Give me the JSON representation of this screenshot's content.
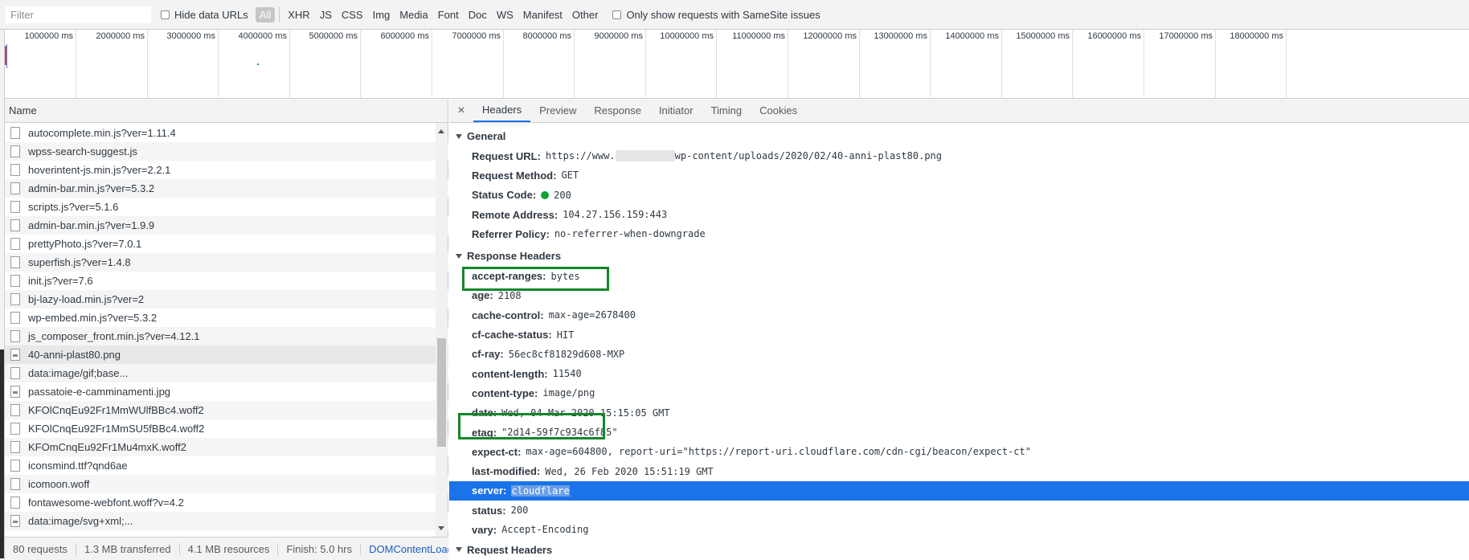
{
  "toolbar": {
    "filter_placeholder": "Filter",
    "hide_data_urls": "Hide data URLs",
    "types": [
      "All",
      "XHR",
      "JS",
      "CSS",
      "Img",
      "Media",
      "Font",
      "Doc",
      "WS",
      "Manifest",
      "Other"
    ],
    "active_type": "All",
    "samesite_label": "Only show requests with SameSite issues"
  },
  "overview": {
    "ticks": [
      "1000000 ms",
      "2000000 ms",
      "3000000 ms",
      "4000000 ms",
      "5000000 ms",
      "6000000 ms",
      "7000000 ms",
      "8000000 ms",
      "9000000 ms",
      "10000000 ms",
      "11000000 ms",
      "12000000 ms",
      "13000000 ms",
      "14000000 ms",
      "15000000 ms",
      "16000000 ms",
      "17000000 ms",
      "18000000 ms"
    ]
  },
  "list": {
    "header": "Name",
    "rows": [
      {
        "name": "autocomplete.min.js?ver=1.11.4",
        "icon": "file-icon"
      },
      {
        "name": "wpss-search-suggest.js",
        "icon": "file-icon"
      },
      {
        "name": "hoverintent-js.min.js?ver=2.2.1",
        "icon": "file-icon"
      },
      {
        "name": "admin-bar.min.js?ver=5.3.2",
        "icon": "file-icon"
      },
      {
        "name": "scripts.js?ver=5.1.6",
        "icon": "file-icon"
      },
      {
        "name": "admin-bar.min.js?ver=1.9.9",
        "icon": "file-icon"
      },
      {
        "name": "prettyPhoto.js?ver=7.0.1",
        "icon": "file-icon"
      },
      {
        "name": "superfish.js?ver=1.4.8",
        "icon": "file-icon"
      },
      {
        "name": "init.js?ver=7.6",
        "icon": "file-icon"
      },
      {
        "name": "bj-lazy-load.min.js?ver=2",
        "icon": "file-icon"
      },
      {
        "name": "wp-embed.min.js?ver=5.3.2",
        "icon": "file-icon"
      },
      {
        "name": "js_composer_front.min.js?ver=4.12.1",
        "icon": "file-icon"
      },
      {
        "name": "40-anni-plast80.png",
        "icon": "image-file-icon"
      },
      {
        "name": "data:image/gif;base...",
        "icon": "file-icon"
      },
      {
        "name": "passatoie-e-camminamenti.jpg",
        "icon": "image-file-icon"
      },
      {
        "name": "KFOlCnqEu92Fr1MmWUlfBBc4.woff2",
        "icon": "file-icon"
      },
      {
        "name": "KFOlCnqEu92Fr1MmSU5fBBc4.woff2",
        "icon": "file-icon"
      },
      {
        "name": "KFOmCnqEu92Fr1Mu4mxK.woff2",
        "icon": "file-icon"
      },
      {
        "name": "iconsmind.ttf?qnd6ae",
        "icon": "file-icon"
      },
      {
        "name": "icomoon.woff",
        "icon": "file-icon"
      },
      {
        "name": "fontawesome-webfont.woff?v=4.2",
        "icon": "file-icon"
      },
      {
        "name": "data:image/svg+xml;...",
        "icon": "image-file-icon"
      }
    ]
  },
  "status_bar": {
    "requests": "80 requests",
    "transferred": "1.3 MB transferred",
    "resources": "4.1 MB resources",
    "finish": "Finish: 5.0 hrs",
    "dom_content_loaded": "DOMContentLoaded"
  },
  "details": {
    "tabs": [
      "Headers",
      "Preview",
      "Response",
      "Initiator",
      "Timing",
      "Cookies"
    ],
    "active_tab": "Headers",
    "general": {
      "title": "General",
      "request_url_label": "Request URL:",
      "request_url_prefix": "https://www.",
      "request_url_suffix": "wp-content/uploads/2020/02/40-anni-plast80.png",
      "request_method_label": "Request Method:",
      "request_method": "GET",
      "status_code_label": "Status Code:",
      "status_code": "200",
      "remote_address_label": "Remote Address:",
      "remote_address": "104.27.156.159:443",
      "referrer_policy_label": "Referrer Policy:",
      "referrer_policy": "no-referrer-when-downgrade"
    },
    "response_headers": {
      "title": "Response Headers",
      "items": [
        {
          "k": "accept-ranges:",
          "v": "bytes"
        },
        {
          "k": "age:",
          "v": "2108"
        },
        {
          "k": "cache-control:",
          "v": "max-age=2678400"
        },
        {
          "k": "cf-cache-status:",
          "v": "HIT"
        },
        {
          "k": "cf-ray:",
          "v": "56ec8cf81829d608-MXP"
        },
        {
          "k": "content-length:",
          "v": "11540"
        },
        {
          "k": "content-type:",
          "v": "image/png"
        },
        {
          "k": "date:",
          "v": "Wed, 04 Mar 2020 15:15:05 GMT"
        },
        {
          "k": "etag:",
          "v": "\"2d14-59f7c934c6f85\""
        },
        {
          "k": "expect-ct:",
          "v": "max-age=604800, report-uri=\"https://report-uri.cloudflare.com/cdn-cgi/beacon/expect-ct\""
        },
        {
          "k": "last-modified:",
          "v": "Wed, 26 Feb 2020 15:51:19 GMT"
        },
        {
          "k": "server:",
          "v": "cloudflare"
        },
        {
          "k": "status:",
          "v": "200"
        },
        {
          "k": "vary:",
          "v": "Accept-Encoding"
        }
      ]
    },
    "request_headers_title": "Request Headers"
  },
  "colors": {
    "accent": "#1a73e8",
    "annotation_box": "#15862a",
    "status_ok": "#0fa335"
  }
}
